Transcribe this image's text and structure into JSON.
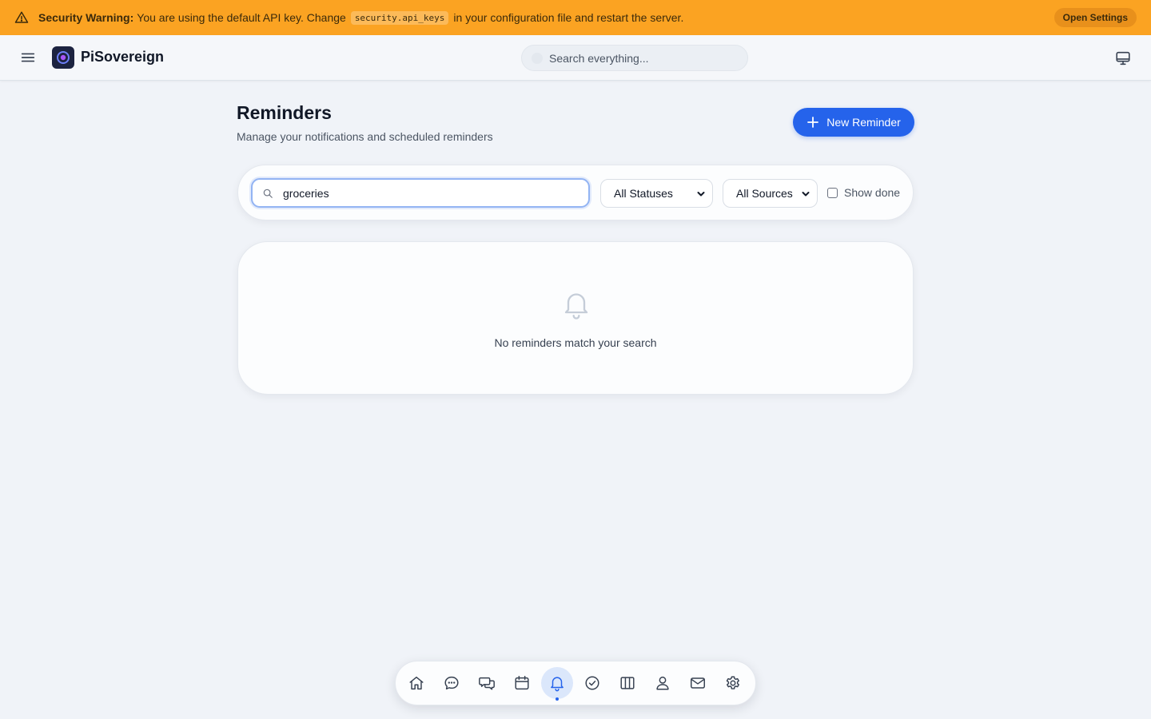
{
  "banner": {
    "icon": "warning-triangle-icon",
    "bold_label": "Security Warning:",
    "text_before": "You are using the default API key. Change",
    "code": "security.api_keys",
    "text_after": "in your configuration file and restart the server.",
    "action_label": "Open Settings",
    "color": "#fba322"
  },
  "header": {
    "brand": "PiSovereign",
    "search_placeholder": "Search everything..."
  },
  "page": {
    "title": "Reminders",
    "subtitle": "Manage your notifications and scheduled reminders",
    "new_button_label": "New Reminder",
    "accent": "#2563eb"
  },
  "filters": {
    "search_value": "groceries",
    "status_selected": "All Statuses",
    "source_selected": "All Sources",
    "show_done_label": "Show done",
    "show_done_checked": false
  },
  "empty_state": {
    "icon": "bell-icon",
    "message": "No reminders match your search"
  },
  "dock": {
    "items": [
      {
        "icon": "home-icon"
      },
      {
        "icon": "chat-icon"
      },
      {
        "icon": "conversations-icon"
      },
      {
        "icon": "calendar-icon"
      },
      {
        "icon": "bell-icon",
        "active": true
      },
      {
        "icon": "check-circle-icon"
      },
      {
        "icon": "columns-icon"
      },
      {
        "icon": "user-icon"
      },
      {
        "icon": "mail-icon"
      },
      {
        "icon": "gear-icon"
      }
    ]
  }
}
